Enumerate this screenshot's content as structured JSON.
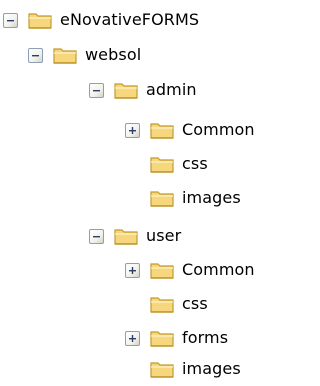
{
  "tree": {
    "nodes": [
      {
        "label": "eNovativeFORMS",
        "expander": "minus"
      },
      {
        "label": "websol",
        "expander": "minus"
      },
      {
        "label": "admin",
        "expander": "minus"
      },
      {
        "label": "Common",
        "expander": "plus"
      },
      {
        "label": "css",
        "expander": "none"
      },
      {
        "label": "images",
        "expander": "none"
      },
      {
        "label": "user",
        "expander": "minus"
      },
      {
        "label": "Common",
        "expander": "plus"
      },
      {
        "label": "css",
        "expander": "none"
      },
      {
        "label": "forms",
        "expander": "plus"
      },
      {
        "label": "images",
        "expander": "none"
      }
    ]
  },
  "colors": {
    "folder_fill": "#f6d77e",
    "folder_stroke": "#c49a2c",
    "expander_border": "#8e9eb6",
    "expander_sign": "#2b3f6b"
  },
  "icons": {
    "expanded": "minus-icon",
    "collapsed": "plus-icon",
    "folder": "folder-icon"
  }
}
